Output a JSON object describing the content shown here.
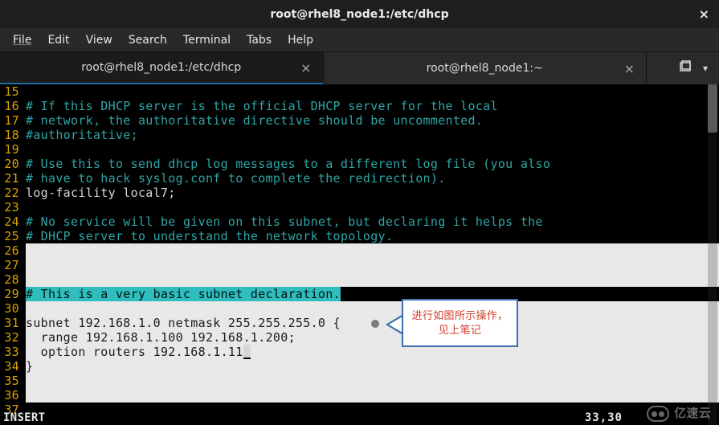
{
  "titlebar": {
    "title": "root@rhel8_node1:/etc/dhcp"
  },
  "menubar": {
    "items": [
      "File",
      "Edit",
      "View",
      "Search",
      "Terminal",
      "Tabs",
      "Help"
    ]
  },
  "tabs": [
    {
      "label": "root@rhel8_node1:/etc/dhcp",
      "active": true
    },
    {
      "label": "root@rhel8_node1:~",
      "active": false
    }
  ],
  "editor": {
    "first_line_number": 15,
    "lines": [
      {
        "n": 15,
        "segs": []
      },
      {
        "n": 16,
        "segs": [
          {
            "cls": "c-comment",
            "t": "# If this DHCP server is the official DHCP server for the local"
          }
        ]
      },
      {
        "n": 17,
        "segs": [
          {
            "cls": "c-comment",
            "t": "# network, the authoritative directive should be uncommented."
          }
        ]
      },
      {
        "n": 18,
        "segs": [
          {
            "cls": "c-comment",
            "t": "#authoritative;"
          }
        ]
      },
      {
        "n": 19,
        "segs": []
      },
      {
        "n": 20,
        "segs": [
          {
            "cls": "c-comment",
            "t": "# Use this to send dhcp log messages to a different log file (you also"
          }
        ]
      },
      {
        "n": 21,
        "segs": [
          {
            "cls": "c-comment",
            "t": "# have to hack syslog.conf to complete the redirection)."
          }
        ]
      },
      {
        "n": 22,
        "segs": [
          {
            "cls": "c-plain",
            "t": "log-facility local7;"
          }
        ]
      },
      {
        "n": 23,
        "segs": []
      },
      {
        "n": 24,
        "segs": [
          {
            "cls": "c-comment",
            "t": "# No service will be given on this subnet, but declaring it helps the"
          }
        ]
      },
      {
        "n": 25,
        "segs": [
          {
            "cls": "c-comment",
            "t": "# DHCP server to understand the network topology."
          }
        ]
      },
      {
        "n": 26,
        "segs": [
          {
            "cls": "hlblock",
            "t": "                                                                                                    "
          }
        ]
      },
      {
        "n": 27,
        "segs": [
          {
            "cls": "hlblock",
            "t": "                                                                                                    "
          }
        ]
      },
      {
        "n": 28,
        "segs": [
          {
            "cls": "hlblock",
            "t": "                                                                                                    "
          }
        ]
      },
      {
        "n": 29,
        "segs": [
          {
            "cls": "hlcomment",
            "t": "# This is a very basic subnet declaration."
          }
        ]
      },
      {
        "n": 30,
        "segs": [
          {
            "cls": "hlblock",
            "t": "                                                                                                    "
          }
        ]
      },
      {
        "n": 31,
        "segs": [
          {
            "cls": "hlblock",
            "t": "subnet 192.168.1.0 netmask 255.255.255.0 {                                                          "
          }
        ]
      },
      {
        "n": 32,
        "segs": [
          {
            "cls": "hlblock",
            "t": "  range 192.168.1.100 192.168.1.200;                                                                "
          }
        ]
      },
      {
        "n": 33,
        "segs": [
          {
            "cls": "hlblock",
            "t": "  option routers 192.168.1.11"
          },
          {
            "cls": "cursor",
            "t": ""
          },
          {
            "cls": "hlblock",
            "t": "                                                                       "
          }
        ]
      },
      {
        "n": 34,
        "segs": [
          {
            "cls": "hlblock",
            "t": "}                                                                                                   "
          }
        ]
      },
      {
        "n": 35,
        "segs": [
          {
            "cls": "hlblock",
            "t": "                                                                                                    "
          }
        ]
      },
      {
        "n": 36,
        "segs": [
          {
            "cls": "hlblock",
            "t": "                                                                                                    "
          }
        ]
      },
      {
        "n": 37,
        "segs": []
      }
    ]
  },
  "status": {
    "mode": "INSERT",
    "position": "33,30"
  },
  "callout": {
    "text": "进行如图所示操作，见上笔记"
  },
  "watermark": {
    "text": "亿速云"
  }
}
